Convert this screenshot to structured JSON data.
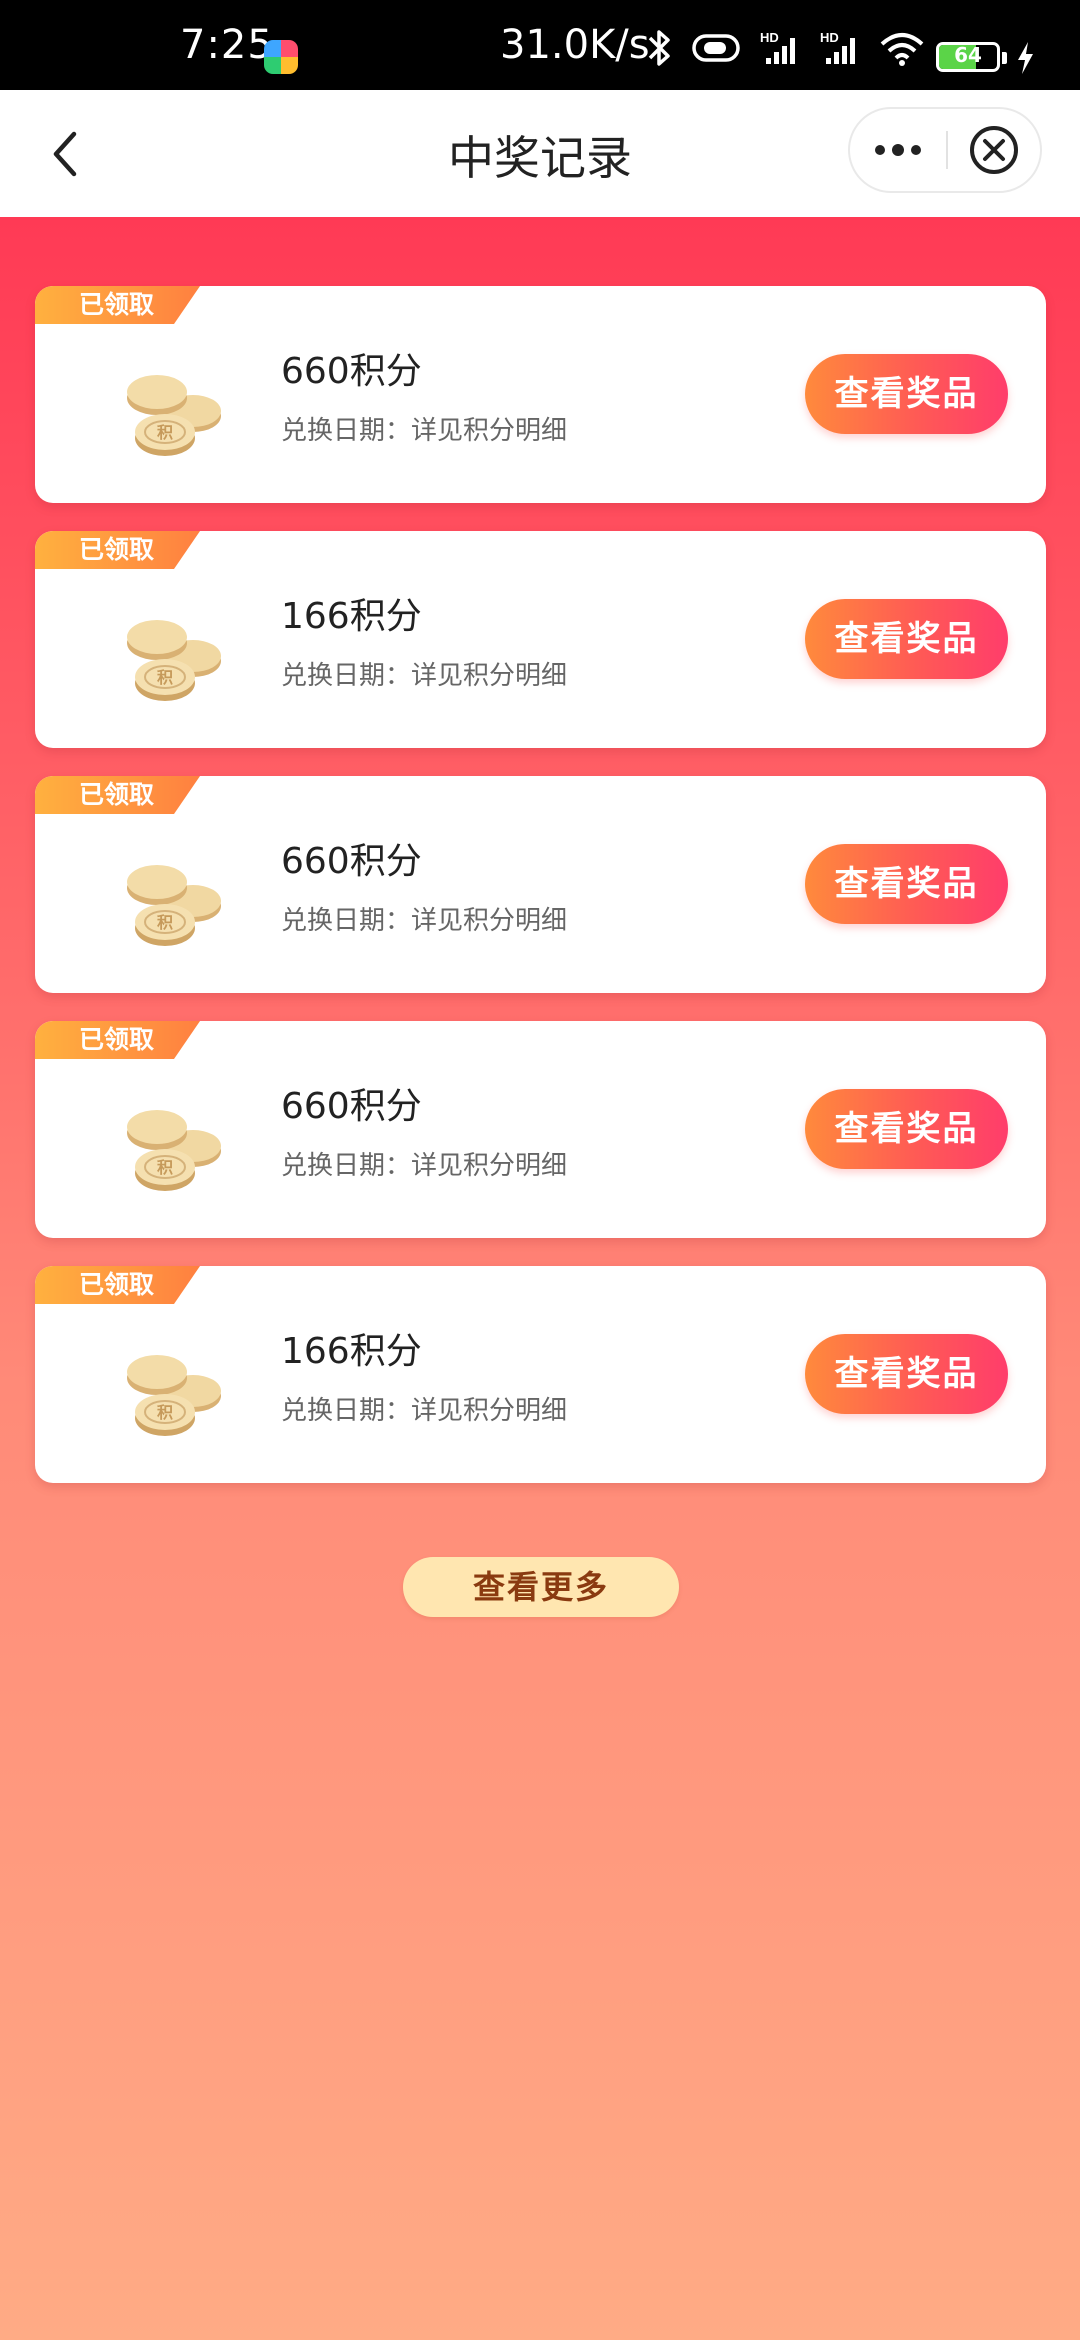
{
  "status_bar": {
    "time": "7:25",
    "network_speed": "31.0K/s",
    "battery": "64",
    "battery_level": 0.64,
    "hd_label_1": "HD",
    "hd_label_2": "HD"
  },
  "nav": {
    "title": "中奖记录",
    "back_icon": "chevron-left-icon",
    "more_icon": "more-dots-icon",
    "close_icon": "close-circle-icon"
  },
  "records": [
    {
      "badge": "已领取",
      "name": "660积分",
      "date": "兑换日期：详见积分明细",
      "button": "查看奖品"
    },
    {
      "badge": "已领取",
      "name": "166积分",
      "date": "兑换日期：详见积分明细",
      "button": "查看奖品"
    },
    {
      "badge": "已领取",
      "name": "660积分",
      "date": "兑换日期：详见积分明细",
      "button": "查看奖品"
    },
    {
      "badge": "已领取",
      "name": "660积分",
      "date": "兑换日期：详见积分明细",
      "button": "查看奖品"
    },
    {
      "badge": "已领取",
      "name": "166积分",
      "date": "兑换日期：详见积分明细",
      "button": "查看奖品"
    }
  ],
  "coin_text": "积",
  "more_button": "查看更多",
  "colors": {
    "accent": "#ff3a55",
    "button_start": "#ff8a3c",
    "button_end": "#ff3d6b",
    "badge": "#ffa03f",
    "more_button_bg": "#ffe6b0"
  }
}
